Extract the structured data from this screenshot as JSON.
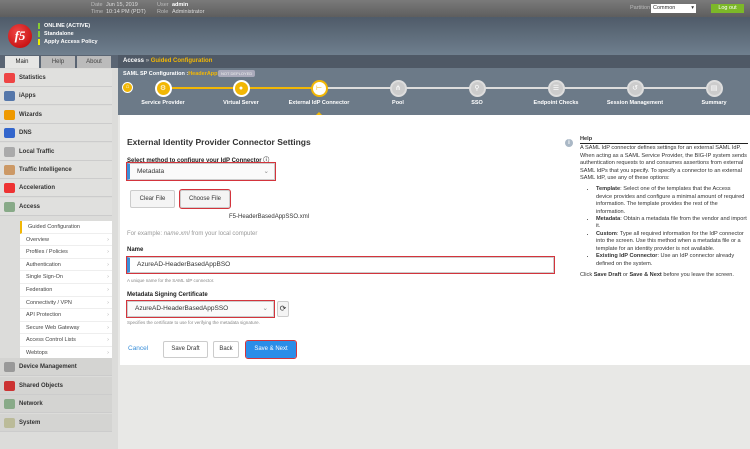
{
  "topbar": {
    "date_label": "Date",
    "date": "Jun 15, 2019",
    "time_label": "Time",
    "time": "10:14 PM (PDT)",
    "user_label": "User",
    "user": "admin",
    "role_label": "Role",
    "role": "Administrator",
    "partition_label": "Partition",
    "partition": "Common",
    "logout": "Log out"
  },
  "status": [
    "ONLINE (ACTIVE)",
    "Standalone",
    "Apply Access Policy"
  ],
  "tabs": [
    "Main",
    "Help",
    "About"
  ],
  "sidebar": {
    "items_top": [
      "Statistics",
      "iApps",
      "Wizards",
      "DNS",
      "Local Traffic",
      "Traffic Intelligence",
      "Acceleration",
      "Access"
    ],
    "access_sub": [
      "Guided Configuration",
      "Overview",
      "Profiles / Policies",
      "Authentication",
      "Single Sign-On",
      "Federation",
      "Connectivity / VPN",
      "API Protection",
      "Secure Web Gateway",
      "Access Control Lists",
      "Webtops"
    ],
    "items_bottom": [
      "Device Management",
      "Shared Objects",
      "Network",
      "System"
    ]
  },
  "breadcrumb": {
    "root": "Access",
    "sep": "»",
    "current": "Guided Configuration"
  },
  "wizard": {
    "title": "SAML SP Configuration :",
    "name": "HeaderAppSSO",
    "badge": "NOT DEPLOYED",
    "steps": [
      "Service Provider",
      "Virtual Server",
      "External IdP Connector",
      "Pool",
      "SSO",
      "Endpoint Checks",
      "Session Management",
      "Summary"
    ]
  },
  "form": {
    "heading": "External Identity Provider Connector Settings",
    "method_label": "Select method to configure your IdP Connector",
    "method": "Metadata",
    "clear_file": "Clear File",
    "choose_file": "Choose File",
    "filename": "F5-HeaderBasedAppSSO.xml",
    "example_pre": "For example: ",
    "example_em": "name.xml",
    "example_post": " from your local computer",
    "name_label": "Name",
    "name_value": "AzureAD-HeaderBasedAppBSO",
    "name_hint": "A unique name for the SAML IdP connector.",
    "cert_label": "Metadata Signing Certificate",
    "cert_value": "AzureAD-HeaderBasedAppSSO",
    "cert_hint": "Specifies the certificate to use for verifying the metadata signature.",
    "cancel": "Cancel",
    "save_draft": "Save Draft",
    "back": "Back",
    "save_next": "Save & Next"
  },
  "help": {
    "title": "Help",
    "intro": "A SAML IdP connector defines settings for an external SAML IdP. When acting as a SAML Service Provider, the BIG-IP system sends authentication requests to and consumes assertions from external SAML IdPs that you specify. To specify a connector to an external SAML IdP, use any of these options:",
    "items": [
      {
        "term": "Template",
        "text": ": Select one of the templates that the Access device provides and configure a minimal amount of required information. The template provides the rest of the information."
      },
      {
        "term": "Metadata",
        "text": ": Obtain a metadata file from the vendor and import it."
      },
      {
        "term": "Custom",
        "text": ": Type all required information for the IdP connector into the screen. Use this method when a metadata file or a template for an identity provider is not available."
      },
      {
        "term": "Existing IdP Connector",
        "text": ": Use an IdP connector already defined on the system."
      }
    ],
    "outro_1": "Click ",
    "save_draft": "Save Draft",
    "outro_2": " or ",
    "save_next": "Save & Next",
    "outro_3": " before you leave the screen."
  }
}
